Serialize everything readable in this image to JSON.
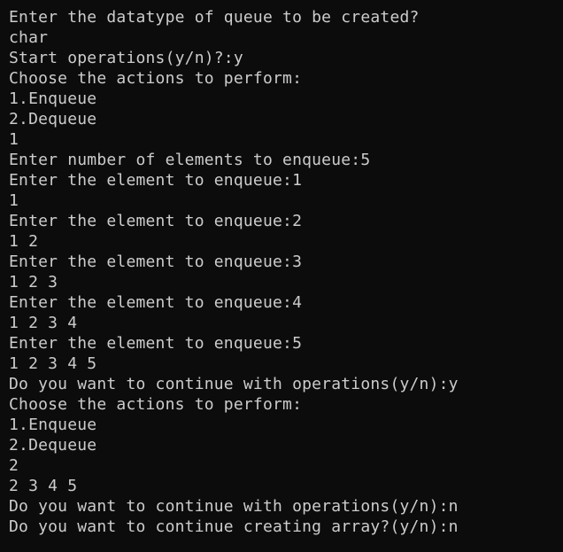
{
  "terminal": {
    "lines": [
      "Enter the datatype of queue to be created?",
      "char",
      "Start operations(y/n)?:y",
      "Choose the actions to perform:",
      "1.Enqueue",
      "2.Dequeue",
      "1",
      "Enter number of elements to enqueue:5",
      "Enter the element to enqueue:1",
      "1",
      "Enter the element to enqueue:2",
      "1 2",
      "Enter the element to enqueue:3",
      "1 2 3",
      "Enter the element to enqueue:4",
      "1 2 3 4",
      "Enter the element to enqueue:5",
      "1 2 3 4 5",
      "Do you want to continue with operations(y/n):y",
      "Choose the actions to perform:",
      "1.Enqueue",
      "2.Dequeue",
      "2",
      "2 3 4 5",
      "Do you want to continue with operations(y/n):n",
      "Do you want to continue creating array?(y/n):n"
    ]
  },
  "colors": {
    "background": "#0c0c0c",
    "text": "#cccccc"
  }
}
